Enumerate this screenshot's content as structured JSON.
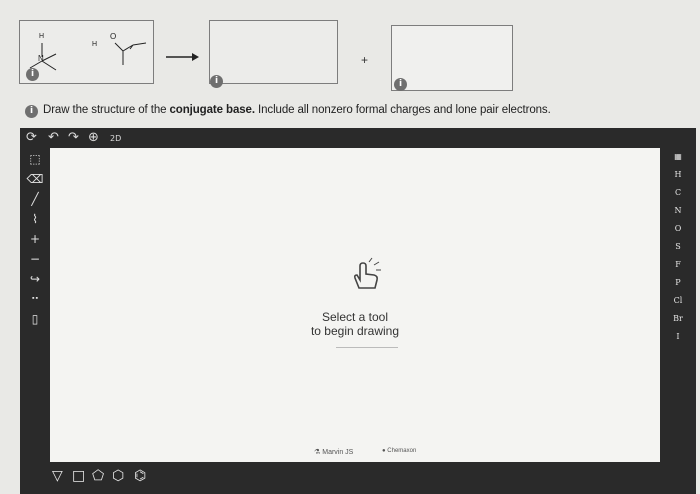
{
  "reaction": {
    "plus_sign": "+",
    "atom_labels": {
      "h_top": "H",
      "n": "N",
      "h_left": "H",
      "o": "O"
    }
  },
  "instruction": {
    "text_before": "Draw the structure of the ",
    "text_bold": "conjugate base.",
    "text_after": " Include all nonzero formal charges and lone pair electrons."
  },
  "editor": {
    "zoom_label": "2D",
    "placeholder_line1": "Select a tool",
    "placeholder_line2": "to begin drawing",
    "footer_brand1": "Marvin JS",
    "footer_brand2": "Chemaxon"
  },
  "elements": [
    "H",
    "C",
    "N",
    "O",
    "S",
    "F",
    "P",
    "Cl",
    "Br",
    "I"
  ],
  "left_tools": [
    "select-tool-icon",
    "eraser-icon",
    "single-bond-icon",
    "chain-icon",
    "plus-charge-icon",
    "minus-charge-icon",
    "arrow-icon",
    "lone-pair-icon",
    "bracket-icon"
  ],
  "shapes": [
    "triangle-icon",
    "square-icon",
    "pentagon-icon",
    "hexagon-icon",
    "benzene-icon"
  ],
  "colors": {
    "toolbar": "#2a2a2a",
    "canvas": "#f4f4f2",
    "info_icon": "#6f6f6f"
  }
}
